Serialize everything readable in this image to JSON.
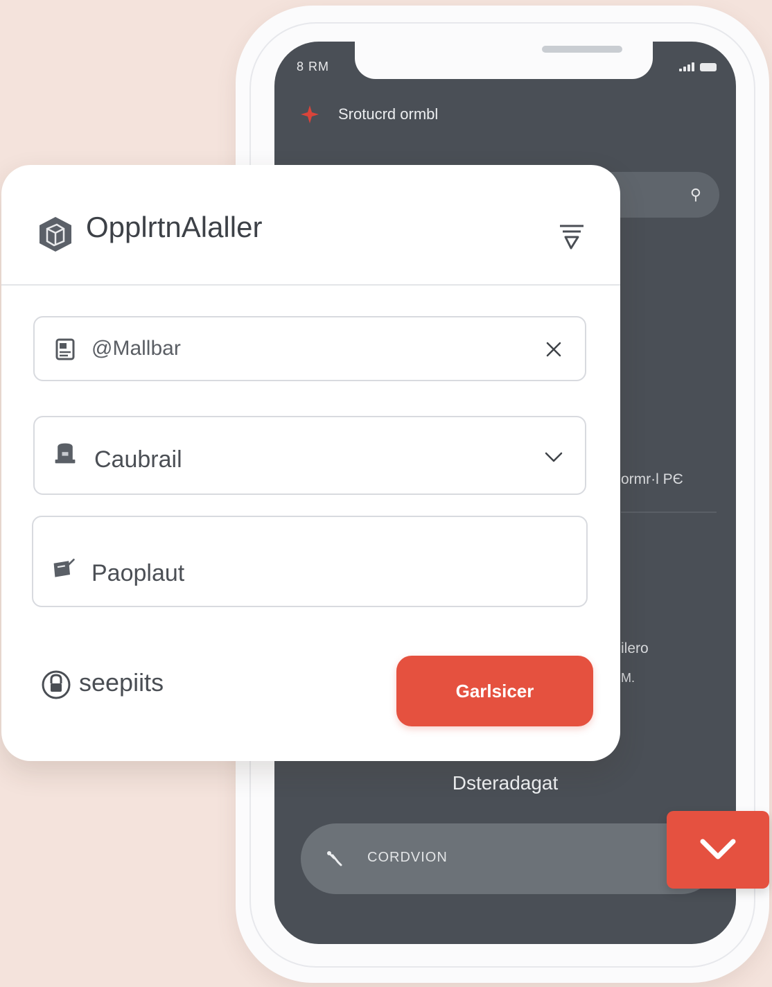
{
  "colors": {
    "background": "#f4e3dc",
    "screen": "#4a4f56",
    "accent": "#e5513f",
    "card": "#ffffff"
  },
  "phone": {
    "status_time": "8 RM",
    "app_title": "Srotucrd ormbl",
    "side_texts": [
      "ormr·l  PЄ",
      "ilero",
      "M."
    ],
    "dashboard_label": "Dsteradagat",
    "bottom_pill_label": "CORDVION",
    "bottom_pill_icon": "tool-icon",
    "confirm_icon": "chevron-down-icon"
  },
  "card": {
    "brand_name": "OpplrtnAlaller",
    "brand_icon": "cube-icon",
    "filter_icon": "filter-icon",
    "fields": [
      {
        "icon": "id-card-icon",
        "value": "@Mallbar",
        "trail_icon": "close-icon"
      },
      {
        "icon": "mailbox-icon",
        "value": "Caubrail",
        "trail_icon": "chevron-down-icon"
      },
      {
        "icon": "cup-icon",
        "value": "Paoplaut"
      }
    ],
    "secure_label": "seepiits",
    "secure_icon": "lock-icon",
    "primary_button": "Garlsicer"
  }
}
